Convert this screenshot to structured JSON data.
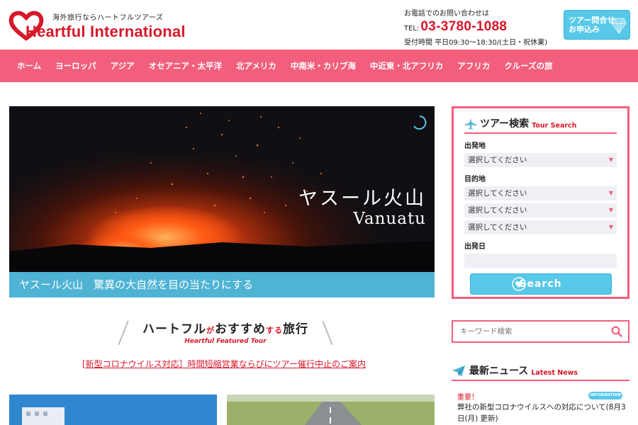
{
  "header": {
    "tagline": "海外旅行ならハートフルツアーズ",
    "brand": "Heartful International",
    "contact_label": "お電話でのお問い合わせは",
    "phone_prefix": "TEL:",
    "phone": "03-3780-1088",
    "hours": "受付時間 平日09:30〜18:30/(土日・祝休業)",
    "apply_line1": "ツアー問合せ",
    "apply_line2": "お申込み",
    "brand_color": "#d7182a",
    "accent_color": "#f25f7d",
    "button_color": "#58c8e8"
  },
  "nav": {
    "items": [
      "ホーム",
      "ヨーロッパ",
      "アジア",
      "オセアニア・太平洋",
      "北アメリカ",
      "中南米・カリブ海",
      "中近東・北アフリカ",
      "アフリカ",
      "クルーズの旅"
    ]
  },
  "hero": {
    "title": "ヤスール火山",
    "subtitle": "Vanuatu",
    "caption": "ヤスール火山　驚異の大自然を目の当たりにする"
  },
  "featured": {
    "title_a": "ハートフル",
    "title_b": "が",
    "title_c": "おすすめ",
    "title_d": "する",
    "title_e": "旅行",
    "subtitle": "Heartful Featured Tour",
    "notice": "[新型コロナウイルス対応］時間短縮営業ならびにツアー催行中止のご案内"
  },
  "search": {
    "title": "ツアー検索",
    "title_en": "Tour Search",
    "departure_label": "出発地",
    "departure_value": "選択してください",
    "destination_label": "目的地",
    "destination_values": [
      "選択してください",
      "選択してください",
      "選択してください"
    ],
    "date_label": "出発日",
    "button": "Search"
  },
  "keyword": {
    "placeholder": "キーワード検索"
  },
  "news": {
    "title": "最新ニュース",
    "title_en": "Latest News",
    "tag": "重要！",
    "badge": "INFORMATION",
    "text": "弊社の新型コロナウイルスへの対応について(8月3日(月) 更新)"
  }
}
